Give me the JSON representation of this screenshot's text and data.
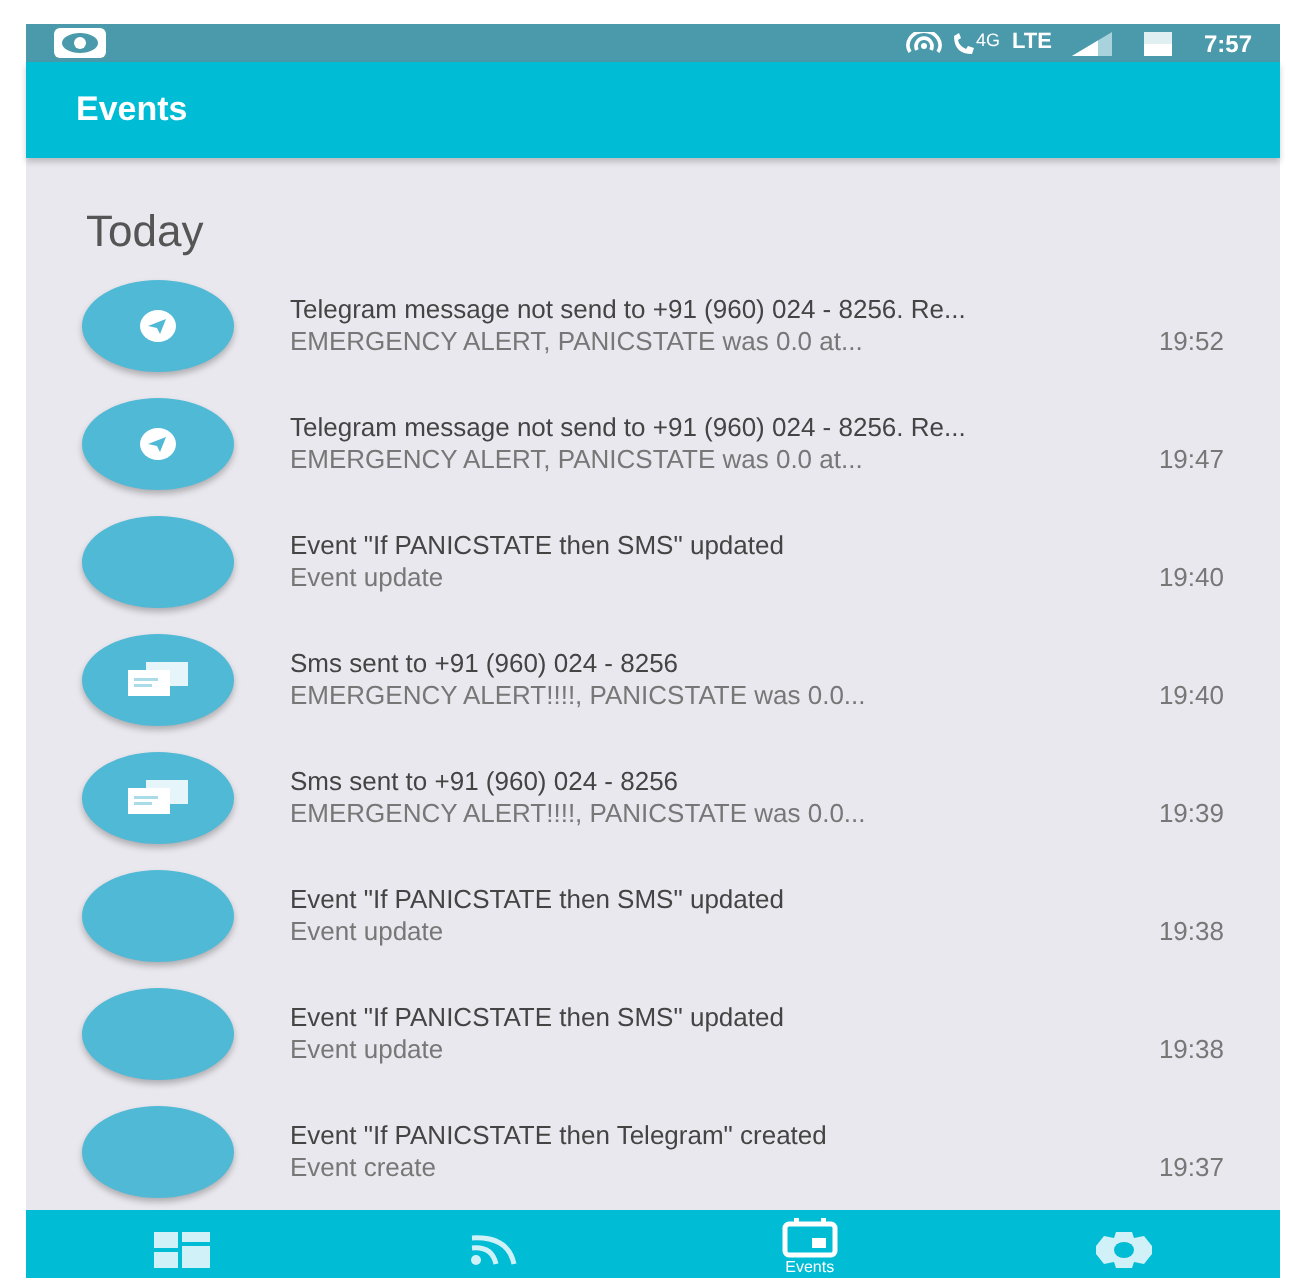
{
  "status_bar": {
    "network": "4G",
    "lte": "LTE",
    "time": "7:57"
  },
  "app_bar": {
    "title": "Events"
  },
  "section": "Today",
  "events": [
    {
      "kind": "telegram",
      "title": "Telegram message not send to +91 (960) 024 - 8256. Re...",
      "detail": "EMERGENCY ALERT, PANICSTATE was 0.0 at...",
      "time": "19:52"
    },
    {
      "kind": "telegram",
      "title": "Telegram message not send to +91 (960) 024 - 8256. Re...",
      "detail": "EMERGENCY ALERT, PANICSTATE was 0.0 at...",
      "time": "19:47"
    },
    {
      "kind": "event",
      "title": "Event \"If PANICSTATE then SMS\" updated",
      "detail": "Event update",
      "time": "19:40"
    },
    {
      "kind": "sms",
      "title": "Sms sent to +91 (960) 024 - 8256",
      "detail": "EMERGENCY ALERT!!!!, PANICSTATE was 0.0...",
      "time": "19:40"
    },
    {
      "kind": "sms",
      "title": "Sms sent to +91 (960) 024 - 8256",
      "detail": "EMERGENCY ALERT!!!!, PANICSTATE was 0.0...",
      "time": "19:39"
    },
    {
      "kind": "event",
      "title": "Event \"If PANICSTATE then SMS\" updated",
      "detail": "Event update",
      "time": "19:38"
    },
    {
      "kind": "event",
      "title": "Event \"If PANICSTATE then SMS\" updated",
      "detail": "Event update",
      "time": "19:38"
    },
    {
      "kind": "event",
      "title": "Event \"If PANICSTATE then Telegram\" created",
      "detail": "Event create",
      "time": "19:37"
    }
  ],
  "bottom_nav": [
    {
      "kind": "dashboard",
      "selected": false
    },
    {
      "kind": "feed",
      "selected": false
    },
    {
      "kind": "events",
      "label": "Events",
      "selected": true
    },
    {
      "kind": "settings",
      "selected": false
    }
  ]
}
